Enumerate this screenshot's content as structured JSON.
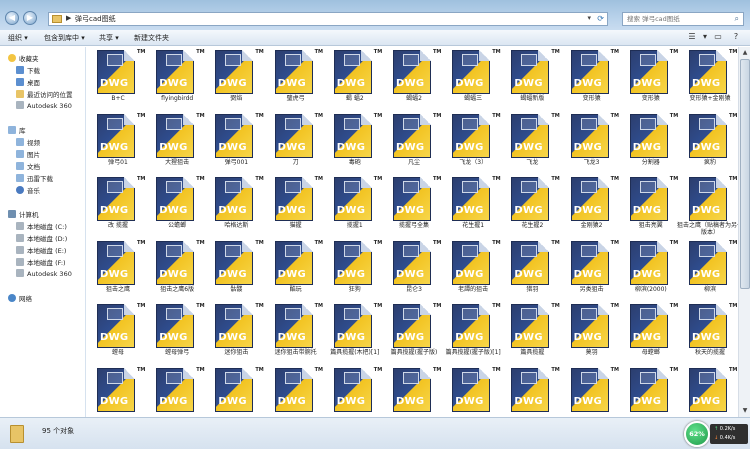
{
  "window": {
    "path_label": "弹弓cad图纸",
    "search_placeholder": "搜索 弹弓cad图纸"
  },
  "toolbar": {
    "organize": "组织 ▾",
    "include": "包含到库中 ▾",
    "share": "共享 ▾",
    "new_folder": "新建文件夹"
  },
  "sidebar": {
    "favorites_header": "收藏夹",
    "favorites": [
      "下载",
      "桌面",
      "最近访问的位置",
      "Autodesk 360"
    ],
    "libraries_header": "库",
    "libraries": [
      "视频",
      "图片",
      "文档",
      "迅雷下载",
      "音乐"
    ],
    "computer_header": "计算机",
    "drives": [
      "本地磁盘 (C:)",
      "本地磁盘 (D:)",
      "本地磁盘 (E:)",
      "本地磁盘 (F:)",
      "Autodesk 360"
    ],
    "network": "网络"
  },
  "files": [
    "B+C",
    "flyingbirdd",
    "弼焰",
    "璧虎弓",
    "蝎 蝠2",
    "蝎蝠2",
    "蝎蝠三",
    "蝎蝠新版",
    "变形猿",
    "变形猿",
    "变形猿+金刚猿",
    "弹弓01",
    "大猩狙击",
    "弹弓001",
    "刀",
    "毒砲",
    "凡尘",
    "飞龙（3）",
    "飞龙",
    "飞龙3",
    "分割器",
    "疯豹",
    "改 揽握",
    "公蟾螂",
    "哈格达斯",
    "猫握",
    "揽握1",
    "揽握弓全集",
    "花生握1",
    "花生握2",
    "金刚猿2",
    "狙击亮翼",
    "狙击之鹰（贴稿者为另一版本）",
    "狙击之鹰",
    "狙击之鹰6版",
    "骷髅",
    "酷玩",
    "狂狗",
    "昆仑3",
    "老譚的狙击",
    "猎羽",
    "另类狙击",
    "柳滨(2000)",
    "柳滨",
    "螳母",
    "螳母弹弓",
    "迷你狙击",
    "迷你狙击带腕托",
    "篇具揽握(木把)[1]",
    "篇具揽握(握子版)",
    "篇具揽握(握子版)[1]",
    "篇具揽握",
    "莫羽",
    "母螳螂",
    "秋天的揽握",
    "",
    "",
    "",
    "",
    "",
    "",
    "",
    "",
    "",
    "",
    ""
  ],
  "status": {
    "count": "95 个对象"
  },
  "speed": {
    "percent": "62%",
    "up": "0.2K/s",
    "down": "0.4K/s"
  }
}
